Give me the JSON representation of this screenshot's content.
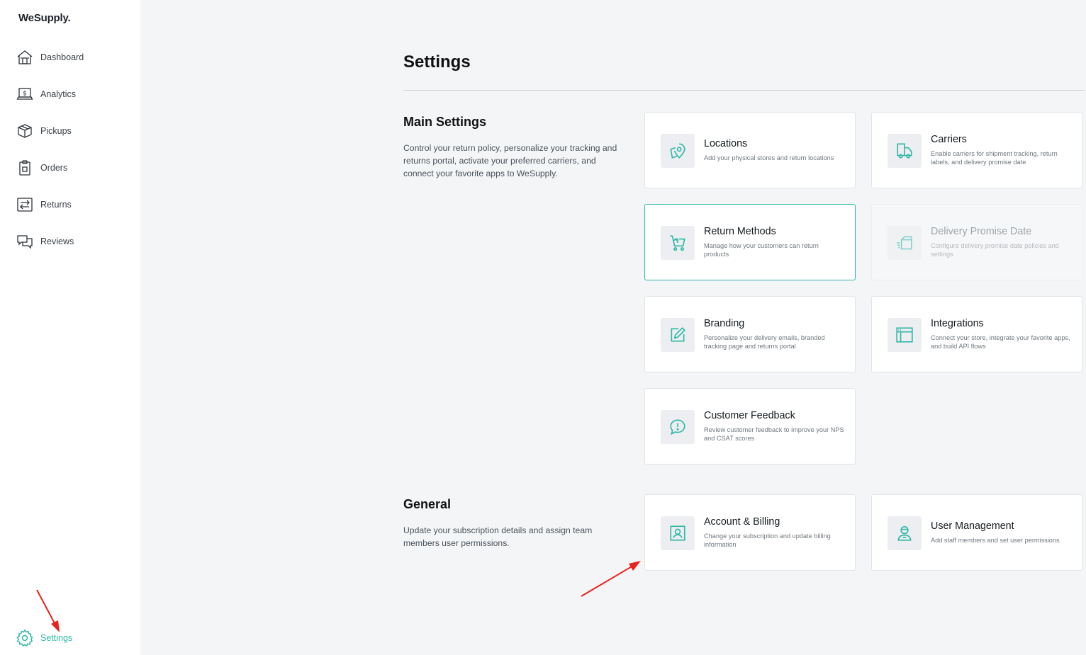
{
  "app": {
    "brand": "WeSupply."
  },
  "sidebar": {
    "items": [
      {
        "label": "Dashboard",
        "icon": "home-icon"
      },
      {
        "label": "Analytics",
        "icon": "laptop-dollar-icon"
      },
      {
        "label": "Pickups",
        "icon": "box-icon"
      },
      {
        "label": "Orders",
        "icon": "clipboard-icon"
      },
      {
        "label": "Returns",
        "icon": "returns-icon"
      },
      {
        "label": "Reviews",
        "icon": "chat-bubbles-icon"
      }
    ],
    "settings": {
      "label": "Settings",
      "icon": "gear-icon",
      "active": true
    }
  },
  "page": {
    "title": "Settings"
  },
  "main_settings": {
    "heading": "Main Settings",
    "description": "Control your return policy, personalize your tracking and returns portal, activate your preferred carriers, and connect your favorite apps to WeSupply.",
    "cards": [
      {
        "title": "Locations",
        "desc": "Add your physical stores and return locations",
        "icon": "location-pin-icon",
        "state": "normal"
      },
      {
        "title": "Carriers",
        "desc": "Enable carriers for shipment tracking, return labels, and delivery promise date",
        "icon": "truck-icon",
        "state": "normal"
      },
      {
        "title": "Return Methods",
        "desc": "Manage how your customers can return products",
        "icon": "cart-return-icon",
        "state": "selected"
      },
      {
        "title": "Delivery Promise Date",
        "desc": "Configure delivery promise date policies and settings",
        "icon": "fast-box-icon",
        "state": "disabled"
      },
      {
        "title": "Branding",
        "desc": "Personalize your delivery emails, branded tracking page and returns portal",
        "icon": "edit-icon",
        "state": "normal"
      },
      {
        "title": "Integrations",
        "desc": "Connect your store, integrate your favorite apps, and build API flows",
        "icon": "browser-window-icon",
        "state": "normal"
      },
      {
        "title": "Customer Feedback",
        "desc": "Review customer feedback to improve your NPS and CSAT scores",
        "icon": "feedback-bubble-icon",
        "state": "normal"
      }
    ]
  },
  "general": {
    "heading": "General",
    "description": "Update your subscription details and assign team members user permissions.",
    "cards": [
      {
        "title": "Account & Billing",
        "desc": "Change your subscription and update billing information",
        "icon": "account-portrait-icon",
        "state": "normal"
      },
      {
        "title": "User Management",
        "desc": "Add staff members and set user permissions",
        "icon": "user-icon",
        "state": "normal"
      }
    ]
  },
  "colors": {
    "accent": "#2fb8a5",
    "annotation": "#e8221c"
  }
}
